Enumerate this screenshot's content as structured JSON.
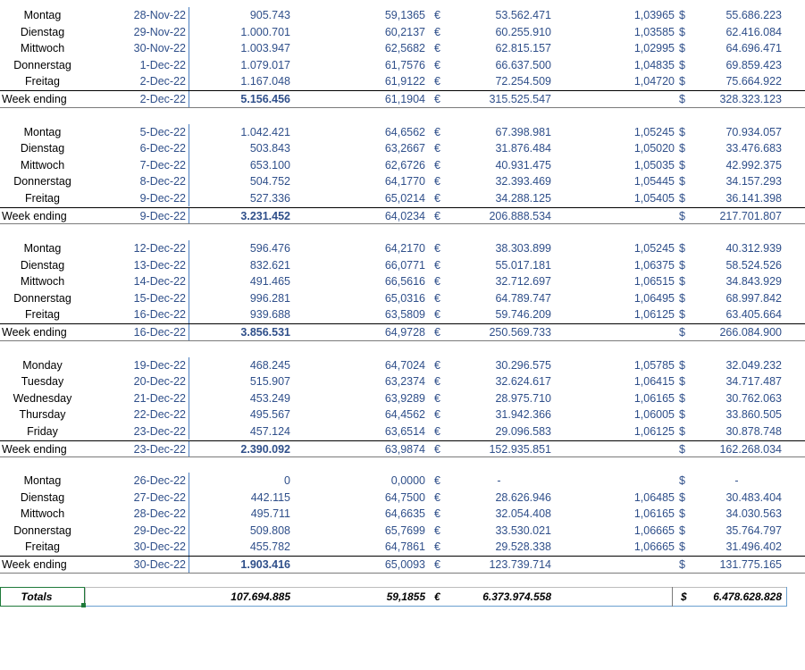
{
  "currency": {
    "eur_symbol": "€",
    "usd_symbol": "$"
  },
  "weeks": [
    {
      "days": [
        {
          "day": "Montag",
          "date": "28-Nov-22",
          "qty": "905.743",
          "rate": "59,1365",
          "eur_value": "53.562.471",
          "fx": "1,03965",
          "usd_value": "55.686.223"
        },
        {
          "day": "Dienstag",
          "date": "29-Nov-22",
          "qty": "1.000.701",
          "rate": "60,2137",
          "eur_value": "60.255.910",
          "fx": "1,03585",
          "usd_value": "62.416.084"
        },
        {
          "day": "Mittwoch",
          "date": "30-Nov-22",
          "qty": "1.003.947",
          "rate": "62,5682",
          "eur_value": "62.815.157",
          "fx": "1,02995",
          "usd_value": "64.696.471"
        },
        {
          "day": "Donnerstag",
          "date": "1-Dec-22",
          "qty": "1.079.017",
          "rate": "61,7576",
          "eur_value": "66.637.500",
          "fx": "1,04835",
          "usd_value": "69.859.423"
        },
        {
          "day": "Freitag",
          "date": "2-Dec-22",
          "qty": "1.167.048",
          "rate": "61,9122",
          "eur_value": "72.254.509",
          "fx": "1,04720",
          "usd_value": "75.664.922"
        }
      ],
      "summary": {
        "label": "Week ending",
        "date": "2-Dec-22",
        "qty": "5.156.456",
        "rate": "61,1904",
        "eur_value": "315.525.547",
        "usd_value": "328.323.123"
      }
    },
    {
      "days": [
        {
          "day": "Montag",
          "date": "5-Dec-22",
          "qty": "1.042.421",
          "rate": "64,6562",
          "eur_value": "67.398.981",
          "fx": "1,05245",
          "usd_value": "70.934.057"
        },
        {
          "day": "Dienstag",
          "date": "6-Dec-22",
          "qty": "503.843",
          "rate": "63,2667",
          "eur_value": "31.876.484",
          "fx": "1,05020",
          "usd_value": "33.476.683"
        },
        {
          "day": "Mittwoch",
          "date": "7-Dec-22",
          "qty": "653.100",
          "rate": "62,6726",
          "eur_value": "40.931.475",
          "fx": "1,05035",
          "usd_value": "42.992.375"
        },
        {
          "day": "Donnerstag",
          "date": "8-Dec-22",
          "qty": "504.752",
          "rate": "64,1770",
          "eur_value": "32.393.469",
          "fx": "1,05445",
          "usd_value": "34.157.293"
        },
        {
          "day": "Freitag",
          "date": "9-Dec-22",
          "qty": "527.336",
          "rate": "65,0214",
          "eur_value": "34.288.125",
          "fx": "1,05405",
          "usd_value": "36.141.398"
        }
      ],
      "summary": {
        "label": "Week ending",
        "date": "9-Dec-22",
        "qty": "3.231.452",
        "rate": "64,0234",
        "eur_value": "206.888.534",
        "usd_value": "217.701.807"
      }
    },
    {
      "days": [
        {
          "day": "Montag",
          "date": "12-Dec-22",
          "qty": "596.476",
          "rate": "64,2170",
          "eur_value": "38.303.899",
          "fx": "1,05245",
          "usd_value": "40.312.939"
        },
        {
          "day": "Dienstag",
          "date": "13-Dec-22",
          "qty": "832.621",
          "rate": "66,0771",
          "eur_value": "55.017.181",
          "fx": "1,06375",
          "usd_value": "58.524.526"
        },
        {
          "day": "Mittwoch",
          "date": "14-Dec-22",
          "qty": "491.465",
          "rate": "66,5616",
          "eur_value": "32.712.697",
          "fx": "1,06515",
          "usd_value": "34.843.929"
        },
        {
          "day": "Donnerstag",
          "date": "15-Dec-22",
          "qty": "996.281",
          "rate": "65,0316",
          "eur_value": "64.789.747",
          "fx": "1,06495",
          "usd_value": "68.997.842"
        },
        {
          "day": "Freitag",
          "date": "16-Dec-22",
          "qty": "939.688",
          "rate": "63,5809",
          "eur_value": "59.746.209",
          "fx": "1,06125",
          "usd_value": "63.405.664"
        }
      ],
      "summary": {
        "label": "Week ending",
        "date": "16-Dec-22",
        "qty": "3.856.531",
        "rate": "64,9728",
        "eur_value": "250.569.733",
        "usd_value": "266.084.900"
      }
    },
    {
      "days": [
        {
          "day": "Monday",
          "date": "19-Dec-22",
          "qty": "468.245",
          "rate": "64,7024",
          "eur_value": "30.296.575",
          "fx": "1,05785",
          "usd_value": "32.049.232"
        },
        {
          "day": "Tuesday",
          "date": "20-Dec-22",
          "qty": "515.907",
          "rate": "63,2374",
          "eur_value": "32.624.617",
          "fx": "1,06415",
          "usd_value": "34.717.487"
        },
        {
          "day": "Wednesday",
          "date": "21-Dec-22",
          "qty": "453.249",
          "rate": "63,9289",
          "eur_value": "28.975.710",
          "fx": "1,06165",
          "usd_value": "30.762.063"
        },
        {
          "day": "Thursday",
          "date": "22-Dec-22",
          "qty": "495.567",
          "rate": "64,4562",
          "eur_value": "31.942.366",
          "fx": "1,06005",
          "usd_value": "33.860.505"
        },
        {
          "day": "Friday",
          "date": "23-Dec-22",
          "qty": "457.124",
          "rate": "63,6514",
          "eur_value": "29.096.583",
          "fx": "1,06125",
          "usd_value": "30.878.748"
        }
      ],
      "summary": {
        "label": "Week ending",
        "date": "23-Dec-22",
        "qty": "2.390.092",
        "rate": "63,9874",
        "eur_value": "152.935.851",
        "usd_value": "162.268.034"
      }
    },
    {
      "days": [
        {
          "day": "Montag",
          "date": "26-Dec-22",
          "qty": "0",
          "rate": "0,0000",
          "eur_value": "-",
          "fx": "",
          "usd_value": "-"
        },
        {
          "day": "Dienstag",
          "date": "27-Dec-22",
          "qty": "442.115",
          "rate": "64,7500",
          "eur_value": "28.626.946",
          "fx": "1,06485",
          "usd_value": "30.483.404"
        },
        {
          "day": "Mittwoch",
          "date": "28-Dec-22",
          "qty": "495.711",
          "rate": "64,6635",
          "eur_value": "32.054.408",
          "fx": "1,06165",
          "usd_value": "34.030.563"
        },
        {
          "day": "Donnerstag",
          "date": "29-Dec-22",
          "qty": "509.808",
          "rate": "65,7699",
          "eur_value": "33.530.021",
          "fx": "1,06665",
          "usd_value": "35.764.797"
        },
        {
          "day": "Freitag",
          "date": "30-Dec-22",
          "qty": "455.782",
          "rate": "64,7861",
          "eur_value": "29.528.338",
          "fx": "1,06665",
          "usd_value": "31.496.402"
        }
      ],
      "summary": {
        "label": "Week ending",
        "date": "30-Dec-22",
        "qty": "1.903.416",
        "rate": "65,0093",
        "eur_value": "123.739.714",
        "usd_value": "131.775.165"
      }
    }
  ],
  "totals": {
    "label": "Totals",
    "qty": "107.694.885",
    "rate": "59,1855",
    "eur_value": "6.373.974.558",
    "usd_value": "6.478.628.828"
  }
}
